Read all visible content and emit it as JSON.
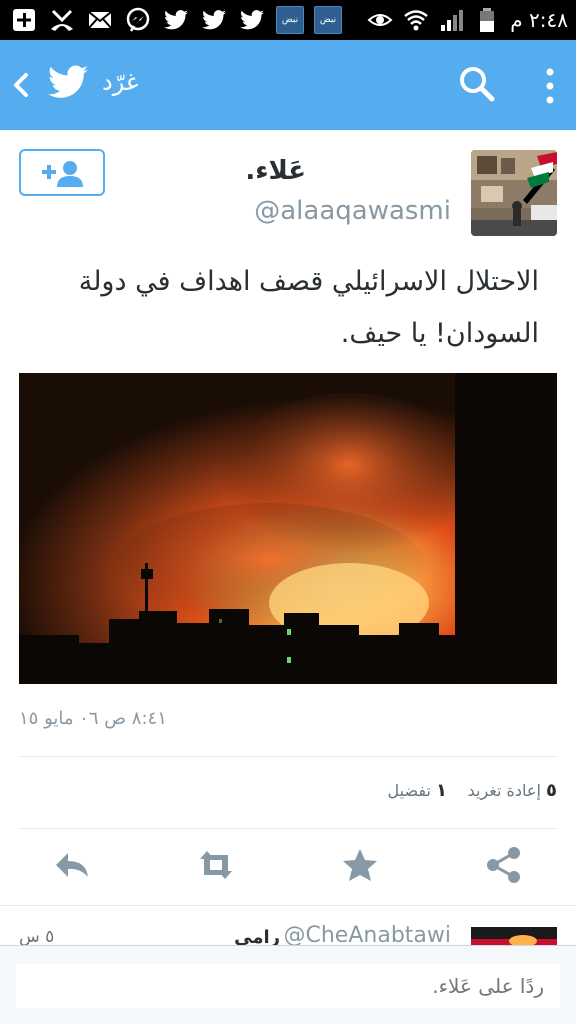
{
  "status_bar": {
    "time": "٢:٤٨ م",
    "notification_icons": [
      "add-box-icon",
      "missed-call-icon",
      "mail-icon",
      "messenger-icon",
      "twitter-icon",
      "twitter-icon",
      "twitter-icon",
      "nabd-app-icon",
      "nabd-app-icon"
    ],
    "nabd_label": "نبض"
  },
  "top_bar": {
    "title": "غرّد",
    "color": "#55acee"
  },
  "tweet": {
    "display_name": "عَلاء.",
    "handle": "@alaaqawasmi",
    "text_line1": "الاحتلال الاسرائيلي قصف اهداف في دولة",
    "text_line2": "السودان! يا حيف.",
    "timestamp": "٨:٤١ ص ٠٦ مايو ١٥",
    "retweets_count": "٥",
    "retweets_label": "إعادة تغريد",
    "favorites_count": "١",
    "favorites_label": "تفضيل"
  },
  "reply_preview": {
    "name": "رامي",
    "handle": "@CheAnabtawi",
    "age": "٥ س"
  },
  "composer": {
    "placeholder": "ردًا على عَلاء."
  }
}
